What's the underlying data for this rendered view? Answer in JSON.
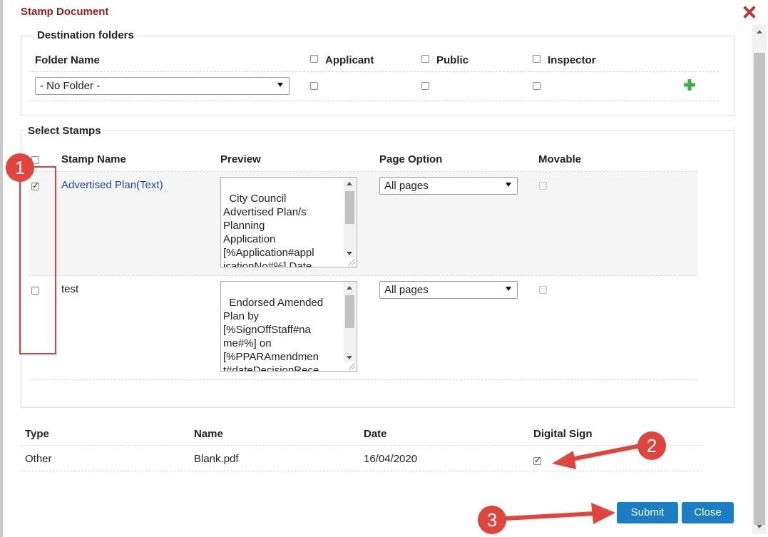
{
  "dialog": {
    "title": "Stamp Document"
  },
  "destination": {
    "legend": "Destination folders",
    "headers": {
      "folder_name": "Folder Name",
      "applicant": "Applicant",
      "public": "Public",
      "inspector": "Inspector"
    },
    "folder_select_value": "- No Folder -"
  },
  "stamps": {
    "legend": "Select Stamps",
    "headers": {
      "stamp_name": "Stamp Name",
      "preview": "Preview",
      "page_option": "Page Option",
      "movable": "Movable"
    },
    "rows": [
      {
        "name": "Advertised Plan(Text)",
        "checked": true,
        "preview": "City Council\nAdvertised Plan/s\nPlanning\nApplication\n[%Application#appl\nicationNo#%] Date\n[%Advertisement#",
        "page_option": "All pages"
      },
      {
        "name": "test",
        "checked": false,
        "preview": "Endorsed Amended\nPlan by\n[%SignOffStaff#na\nme#%] on\n[%PPARAmendmen\nt#dateDecisionRece\nived#Date%]",
        "page_option": "All pages"
      }
    ]
  },
  "documents": {
    "headers": {
      "type": "Type",
      "name": "Name",
      "date": "Date",
      "digital_sign": "Digital Sign"
    },
    "rows": [
      {
        "type": "Other",
        "name": "Blank.pdf",
        "date": "16/04/2020",
        "digital_sign": true
      }
    ]
  },
  "buttons": {
    "submit": "Submit",
    "close": "Close"
  },
  "annotations": {
    "badge1": "1",
    "badge2": "2",
    "badge3": "3",
    "color": "#e0453d"
  }
}
